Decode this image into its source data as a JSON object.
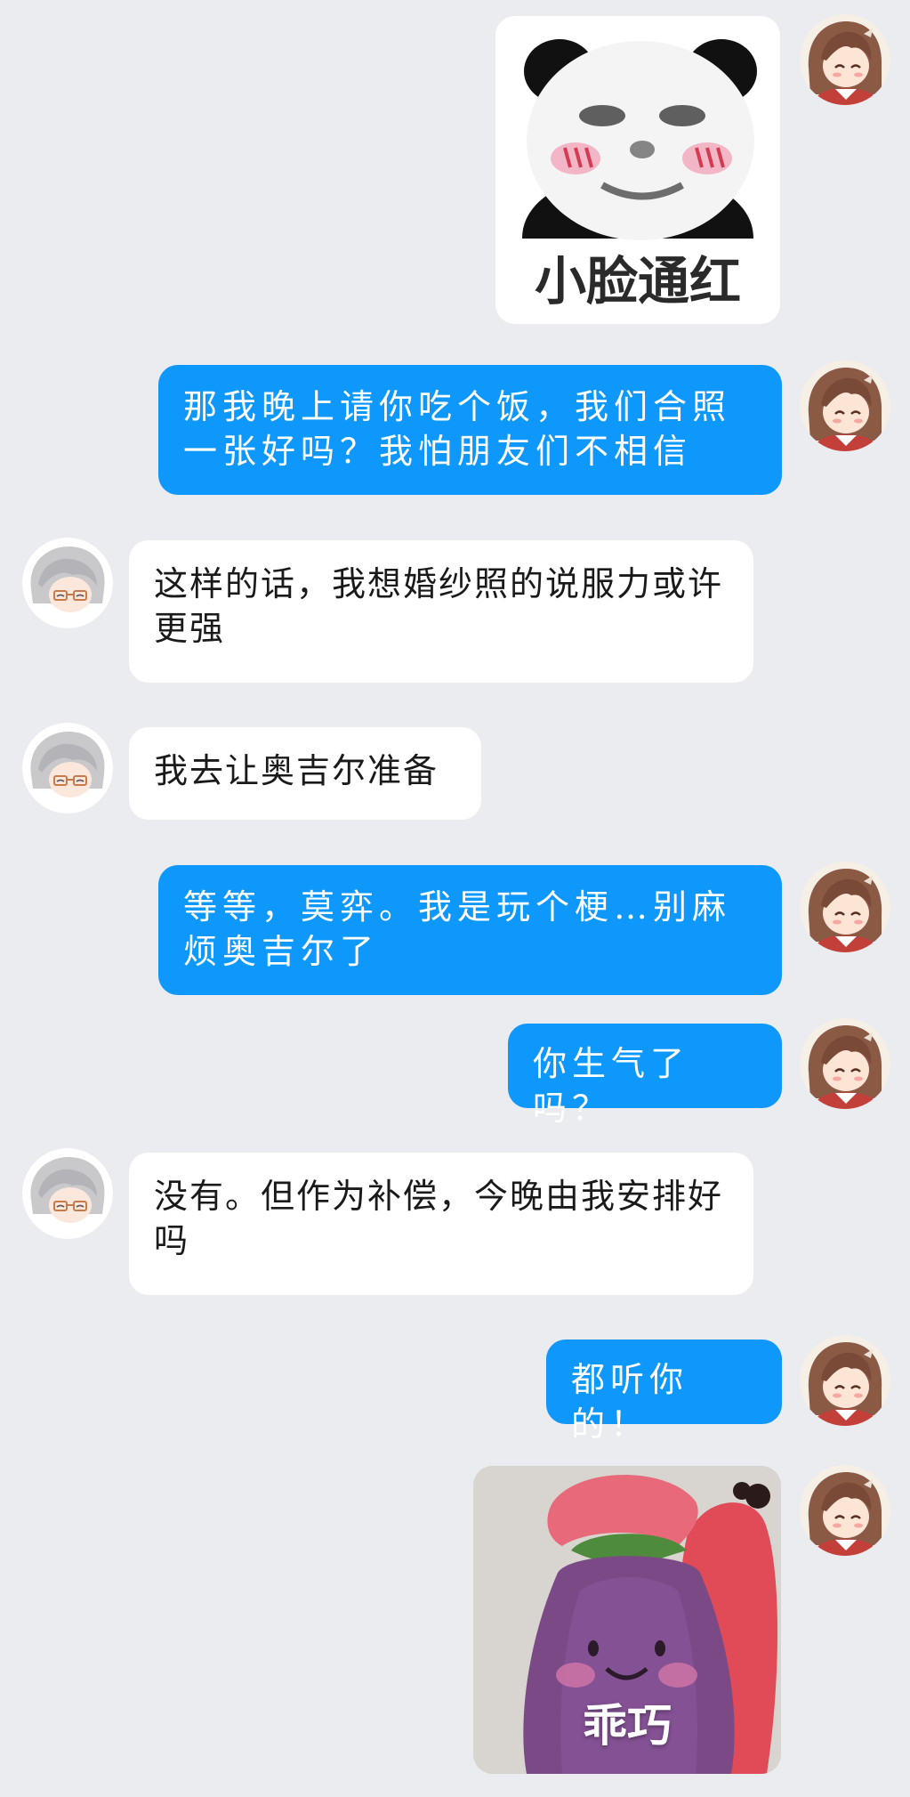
{
  "messages": [
    {
      "sender": "me",
      "type": "sticker",
      "caption": "小脸通红",
      "sticker_icon": "panda-meme-blushing"
    },
    {
      "sender": "me",
      "type": "text",
      "text": "那我晚上请你吃个饭，我们合照一张好吗？我怕朋友们不相信"
    },
    {
      "sender": "other",
      "type": "text",
      "text": "这样的话，我想婚纱照的说服力或许更强"
    },
    {
      "sender": "other",
      "type": "text",
      "text": "我去让奥吉尔准备"
    },
    {
      "sender": "me",
      "type": "text",
      "text": "等等，莫弈。我是玩个梗…别麻烦奥吉尔了"
    },
    {
      "sender": "me",
      "type": "text",
      "text": "你生气了吗？"
    },
    {
      "sender": "other",
      "type": "text",
      "text": "没有。但作为补偿，今晚由我安排好吗"
    },
    {
      "sender": "me",
      "type": "text",
      "text": "都听你的！"
    },
    {
      "sender": "me",
      "type": "sticker",
      "caption": "乖巧",
      "sticker_icon": "eggplant-plush-photo"
    }
  ],
  "colors": {
    "background": "#ebecf0",
    "my_bubble": "#0f98fb",
    "their_bubble": "#ffffff"
  },
  "avatars": {
    "me": "brown-hair-girl-avatar-icon",
    "other": "white-hair-glasses-man-avatar-icon"
  }
}
